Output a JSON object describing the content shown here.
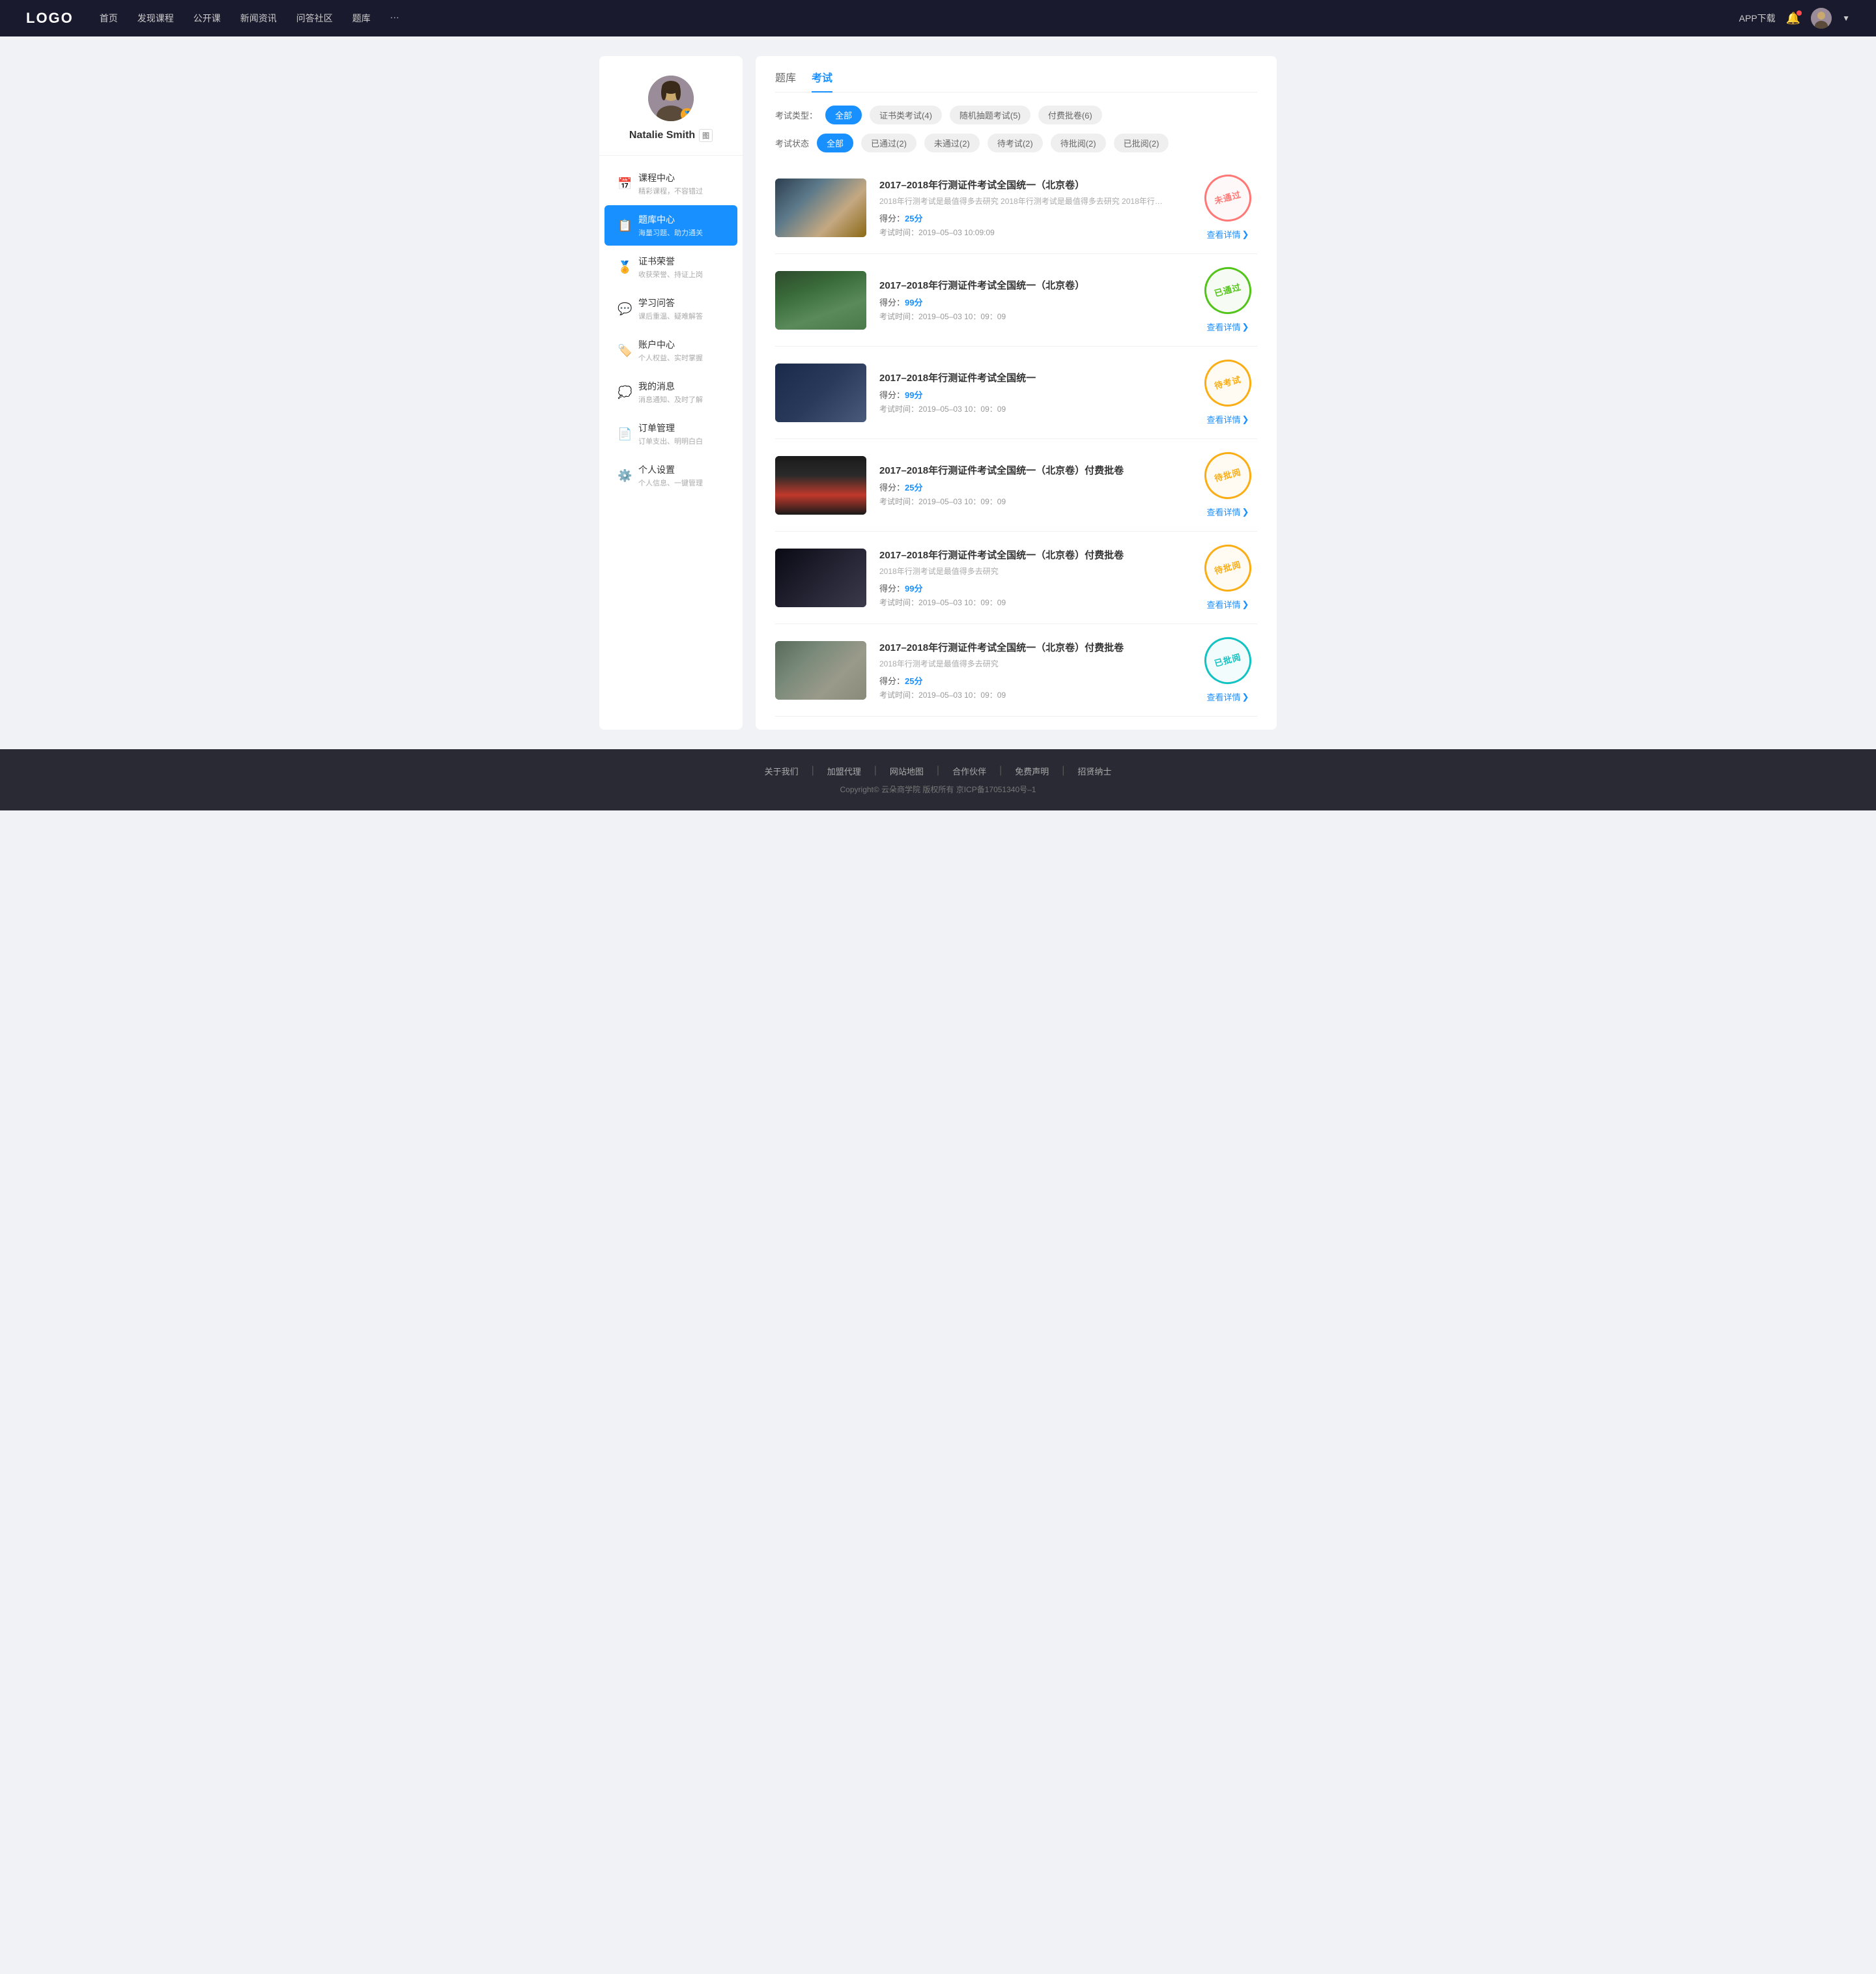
{
  "nav": {
    "logo": "LOGO",
    "menu": [
      {
        "label": "首页"
      },
      {
        "label": "发现课程"
      },
      {
        "label": "公开课"
      },
      {
        "label": "新闻资讯"
      },
      {
        "label": "问答社区"
      },
      {
        "label": "题库"
      },
      {
        "label": "···"
      }
    ],
    "app_download": "APP下载",
    "user_name": "Natalie Smith"
  },
  "sidebar": {
    "user": {
      "name": "Natalie Smith",
      "badge": "图"
    },
    "nav_items": [
      {
        "id": "course",
        "title": "课程中心",
        "sub": "精彩课程，不容错过",
        "icon": "📅"
      },
      {
        "id": "question-bank",
        "title": "题库中心",
        "sub": "海量习题、助力通关",
        "icon": "📋"
      },
      {
        "id": "certificate",
        "title": "证书荣誉",
        "sub": "收获荣誉、持证上岗",
        "icon": "🏅"
      },
      {
        "id": "qa",
        "title": "学习问答",
        "sub": "课后重温、疑难解答",
        "icon": "💬"
      },
      {
        "id": "account",
        "title": "账户中心",
        "sub": "个人权益、实时掌握",
        "icon": "🏷️"
      },
      {
        "id": "messages",
        "title": "我的消息",
        "sub": "消息通知、及时了解",
        "icon": "💭"
      },
      {
        "id": "orders",
        "title": "订单管理",
        "sub": "订单支出、明明白白",
        "icon": "📄"
      },
      {
        "id": "settings",
        "title": "个人设置",
        "sub": "个人信息、一键管理",
        "icon": "⚙️"
      }
    ]
  },
  "main": {
    "tabs": [
      {
        "label": "题库",
        "active": false
      },
      {
        "label": "考试",
        "active": true
      }
    ],
    "type_filter": {
      "label": "考试类型：",
      "items": [
        {
          "label": "全部",
          "active": true
        },
        {
          "label": "证书类考试(4)",
          "active": false
        },
        {
          "label": "随机抽题考试(5)",
          "active": false
        },
        {
          "label": "付费批卷(6)",
          "active": false
        }
      ]
    },
    "status_filter": {
      "label": "考试状态",
      "items": [
        {
          "label": "全部",
          "active": true
        },
        {
          "label": "已通过(2)",
          "active": false
        },
        {
          "label": "未通过(2)",
          "active": false
        },
        {
          "label": "待考试(2)",
          "active": false
        },
        {
          "label": "待批阅(2)",
          "active": false
        },
        {
          "label": "已批阅(2)",
          "active": false
        }
      ]
    },
    "exams": [
      {
        "id": 1,
        "title": "2017–2018年行测证件考试全国统一（北京卷）",
        "desc": "2018年行测考试是最值得多去研究 2018年行测考试是最值得多去研究 2018年行…",
        "score_label": "得分：",
        "score": "25分",
        "time_label": "考试时间：",
        "time": "2019–05–03  10:09:09",
        "status": "failed",
        "status_text": "未通过",
        "thumb_class": "thumb-1",
        "detail_label": "查看详情"
      },
      {
        "id": 2,
        "title": "2017–2018年行测证件考试全国统一（北京卷）",
        "desc": "",
        "score_label": "得分：",
        "score": "99分",
        "time_label": "考试时间：",
        "time": "2019–05–03  10：09：09",
        "status": "passed",
        "status_text": "已通过",
        "thumb_class": "thumb-2",
        "detail_label": "查看详情"
      },
      {
        "id": 3,
        "title": "2017–2018年行测证件考试全国统一",
        "desc": "",
        "score_label": "得分：",
        "score": "99分",
        "time_label": "考试时间：",
        "time": "2019–05–03  10：09：09",
        "status": "pending",
        "status_text": "待考试",
        "thumb_class": "thumb-3",
        "detail_label": "查看详情"
      },
      {
        "id": 4,
        "title": "2017–2018年行测证件考试全国统一（北京卷）付费批卷",
        "desc": "",
        "score_label": "得分：",
        "score": "25分",
        "time_label": "考试时间：",
        "time": "2019–05–03  10：09：09",
        "status": "pending",
        "status_text": "待批阅",
        "thumb_class": "thumb-4",
        "detail_label": "查看详情"
      },
      {
        "id": 5,
        "title": "2017–2018年行测证件考试全国统一（北京卷）付费批卷",
        "desc": "2018年行测考试是最值得多去研究",
        "score_label": "得分：",
        "score": "99分",
        "time_label": "考试时间：",
        "time": "2019–05–03  10：09：09",
        "status": "pending",
        "status_text": "待批阅",
        "thumb_class": "thumb-5",
        "detail_label": "查看详情"
      },
      {
        "id": 6,
        "title": "2017–2018年行测证件考试全国统一（北京卷）付费批卷",
        "desc": "2018年行测考试是最值得多去研究",
        "score_label": "得分：",
        "score": "25分",
        "time_label": "考试时间：",
        "time": "2019–05–03  10：09：09",
        "status": "reviewed",
        "status_text": "已批阅",
        "thumb_class": "thumb-6",
        "detail_label": "查看详情"
      }
    ]
  },
  "footer": {
    "links": [
      "关于我们",
      "加盟代理",
      "网站地图",
      "合作伙伴",
      "免费声明",
      "招贤纳士"
    ],
    "copyright": "Copyright© 云朵商学院  版权所有    京ICP备17051340号–1"
  }
}
